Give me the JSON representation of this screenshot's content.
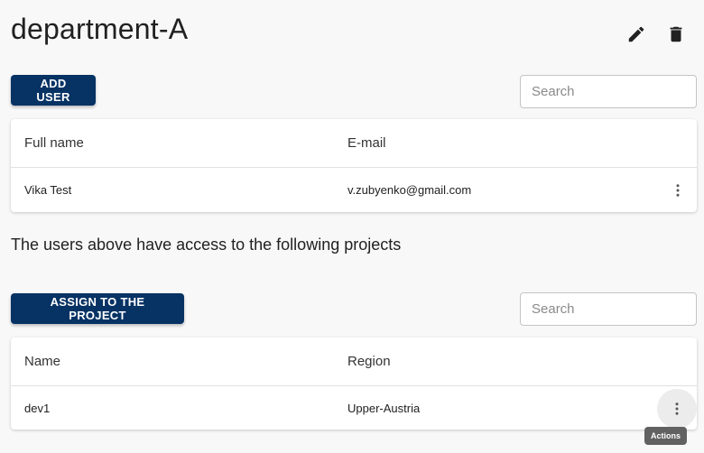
{
  "header": {
    "title": "department-A",
    "edit_icon": "pencil-icon",
    "delete_icon": "trash-icon"
  },
  "users": {
    "add_button": "ADD USER",
    "search_placeholder": "Search",
    "columns": [
      "Full name",
      "E-mail"
    ],
    "rows": [
      {
        "name": "Vika Test",
        "email": "v.zubyenko@gmail.com"
      }
    ]
  },
  "projects": {
    "heading": "The users above have access to the following projects",
    "assign_button": "ASSIGN TO THE PROJECT",
    "search_placeholder": "Search",
    "columns": [
      "Name",
      "Region"
    ],
    "rows": [
      {
        "name": "dev1",
        "region": "Upper-Austria"
      }
    ]
  },
  "tooltip": "Actions",
  "colors": {
    "primary": "#063264",
    "background": "#f8f8f8"
  }
}
